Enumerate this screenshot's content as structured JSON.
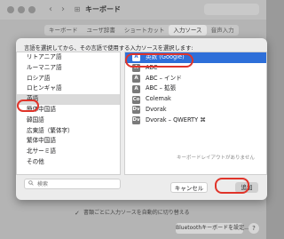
{
  "window": {
    "title": "キーボード",
    "tabs": [
      "キーボード",
      "ユーザ辞書",
      "ショートカット",
      "入力ソース",
      "音声入力"
    ],
    "active_tab_index": 3
  },
  "background": {
    "checkbox_label": "書類ごとに入力ソースを自動的に切り替える",
    "bluetooth_button": "Bluetoothキーボードを設定...",
    "help_label": "?"
  },
  "sheet": {
    "prompt": "言語を選択してから、その言語で使用する入力ソースを選択します:",
    "languages": [
      "リトアニア語",
      "ルーマニア語",
      "ロシア語",
      "ロヒンギャ語",
      "英語",
      "簡体中国語",
      "韓国語",
      "広東語（繁体字）",
      "繁体中国語",
      "北サーミ語",
      "その他"
    ],
    "selected_language_index": 4,
    "sources": [
      {
        "icon": "A",
        "label": "英数 (Google)"
      },
      {
        "icon": "A",
        "label": "ABC"
      },
      {
        "icon": "A",
        "label": "ABC – インド"
      },
      {
        "icon": "A",
        "label": "ABC – 拡張"
      },
      {
        "icon": "Co",
        "label": "Colemak"
      },
      {
        "icon": "Dv",
        "label": "Dvorak"
      },
      {
        "icon": "Dv",
        "label": "Dvorak – QWERTY ⌘"
      }
    ],
    "selected_source_index": 0,
    "no_layout_text": "キーボードレイアウトがありません",
    "search_placeholder": "検索",
    "cancel_label": "キャンセル",
    "add_label": "追加"
  },
  "colors": {
    "accent": "#2e6fd9",
    "annotation": "#e0342a"
  }
}
